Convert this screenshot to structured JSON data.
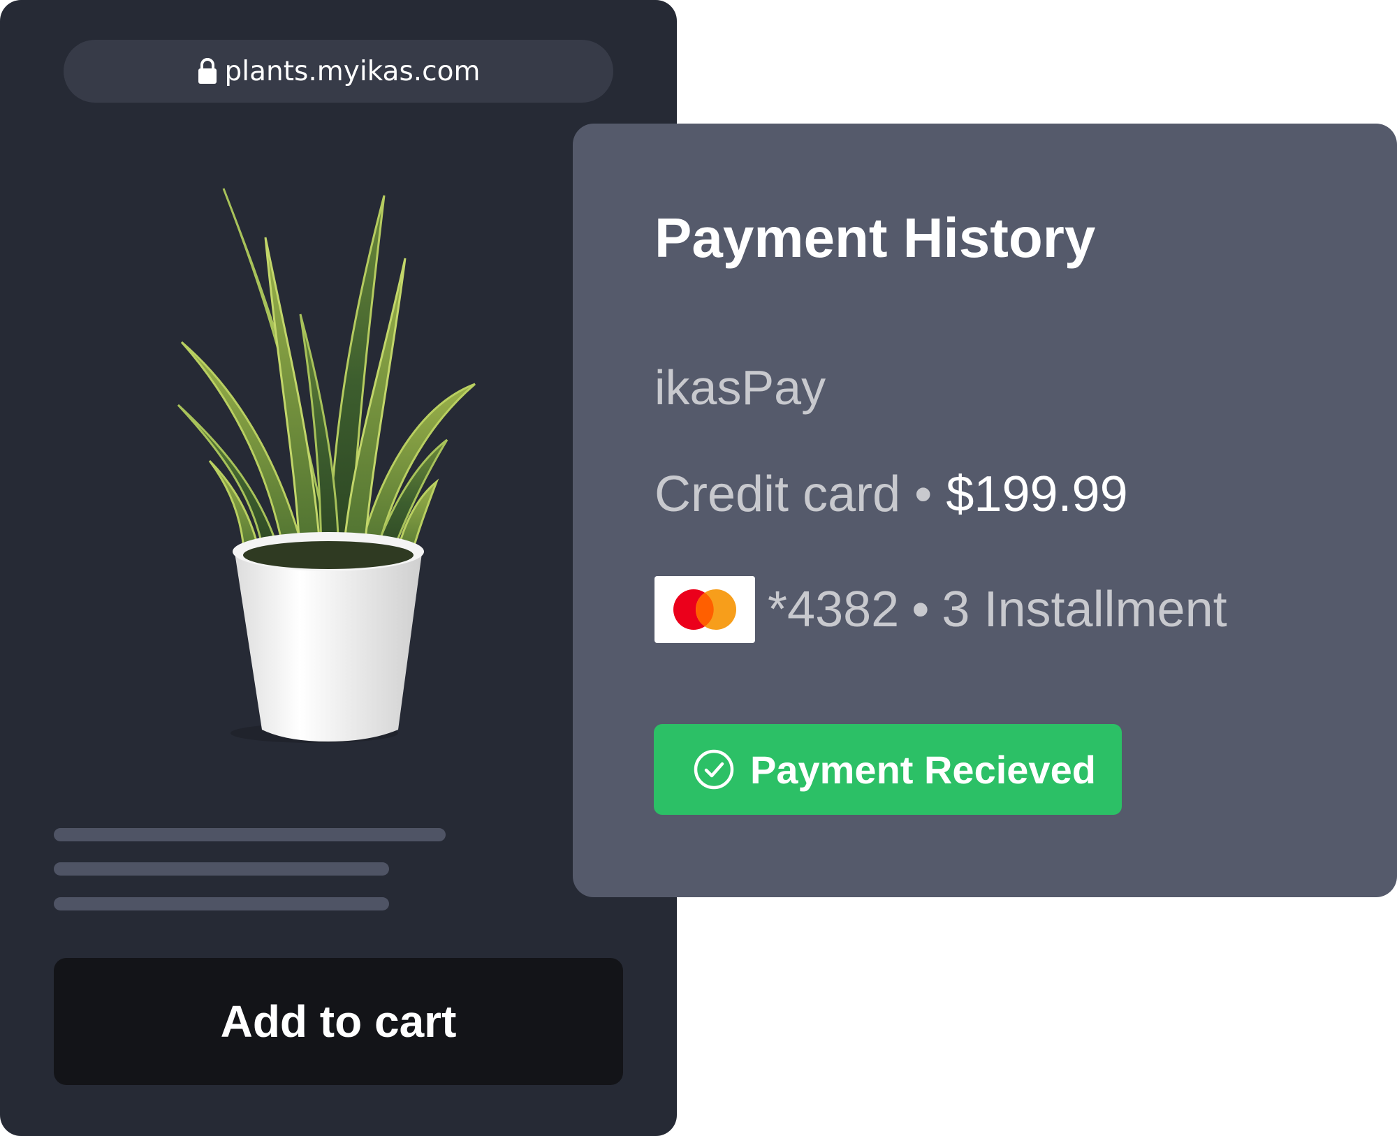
{
  "storefront": {
    "url": "plants.myikas.com",
    "url_icon": "lock-icon",
    "product_image": "snake-plant-in-white-pot",
    "add_to_cart_label": "Add to cart"
  },
  "payment_history": {
    "title": "Payment History",
    "provider": "ikasPay",
    "method": "Credit card",
    "separator": "•",
    "amount": "$199.99",
    "card_brand_icon": "mastercard-logo",
    "card_last_digits": "*4382",
    "installments": "3 Installment",
    "status_label": "Payment Recieved",
    "status_icon": "check-circle-icon",
    "status_color": "#2cc066"
  },
  "colors": {
    "storefront_bg": "#262a35",
    "url_bar_bg": "#373b48",
    "card_bg": "#555a6b",
    "button_bg": "#131418",
    "muted_text": "#c8c9ce"
  }
}
